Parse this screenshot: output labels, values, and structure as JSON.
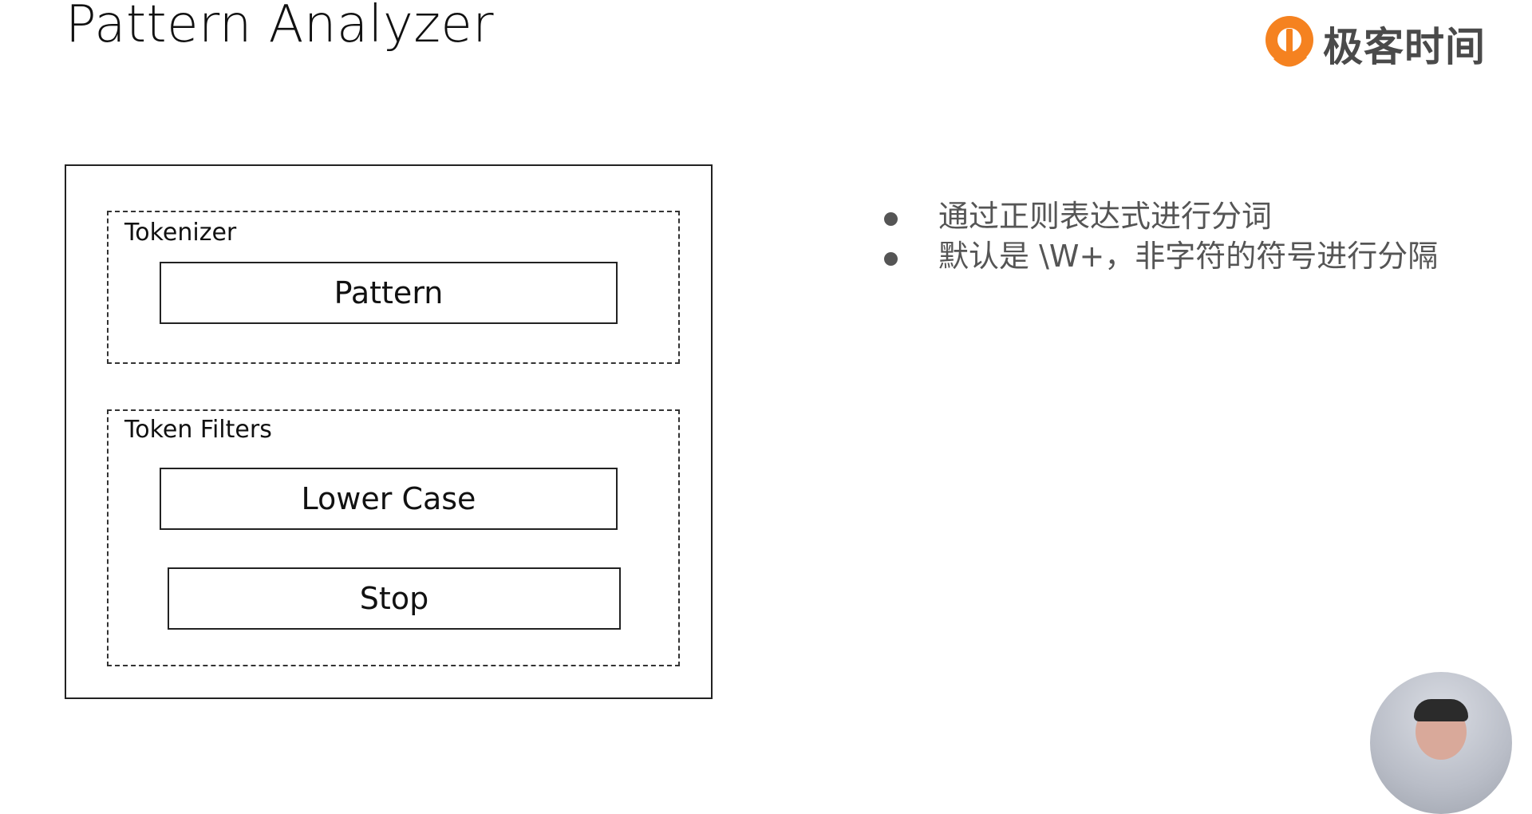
{
  "header": {
    "title": "Pattern Analyzer"
  },
  "logo": {
    "text": "极客时间",
    "icon": "geektime-logo-icon",
    "color": "#f58220"
  },
  "diagram": {
    "tokenizer": {
      "label": "Tokenizer",
      "components": [
        "Pattern"
      ]
    },
    "token_filters": {
      "label": "Token Filters",
      "components": [
        "Lower Case",
        "Stop"
      ]
    }
  },
  "bullets": [
    "通过正则表达式进行分词",
    "默认是 \\W+，非字符的符号进行分隔"
  ]
}
